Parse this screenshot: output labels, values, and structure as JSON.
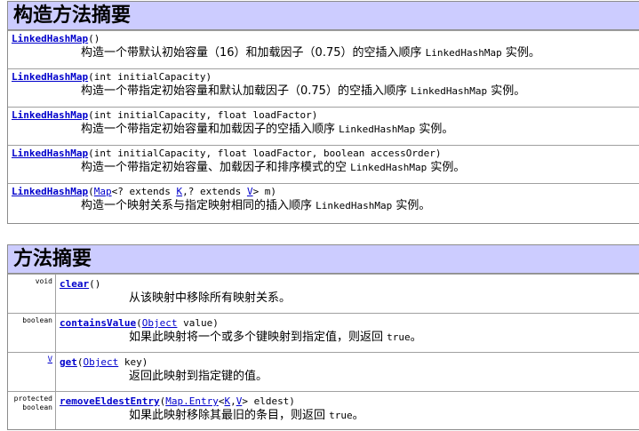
{
  "constructors": {
    "heading": "构造方法摘要",
    "rows": [
      {
        "name": "LinkedHashMap",
        "params": "()",
        "desc": "构造一个带默认初始容量（16）和加载因子（0.75）的空插入顺序 ",
        "desc_code": "LinkedHashMap",
        "desc_tail": " 实例。"
      },
      {
        "name": "LinkedHashMap",
        "params": "(int initialCapacity)",
        "desc": "构造一个带指定初始容量和默认加载因子（0.75）的空插入顺序 ",
        "desc_code": "LinkedHashMap",
        "desc_tail": " 实例。"
      },
      {
        "name": "LinkedHashMap",
        "params": "(int initialCapacity, float loadFactor)",
        "desc": "构造一个带指定初始容量和加载因子的空插入顺序 ",
        "desc_code": "LinkedHashMap",
        "desc_tail": " 实例。"
      },
      {
        "name": "LinkedHashMap",
        "params": "(int initialCapacity, float loadFactor, boolean accessOrder)",
        "desc": "构造一个带指定初始容量、加载因子和排序模式的空 ",
        "desc_code": "LinkedHashMap",
        "desc_tail": " 实例。"
      },
      {
        "name": "LinkedHashMap",
        "params_open": "(",
        "type_map": "Map",
        "params_mid1": "<? extends ",
        "type_k": "K",
        "params_mid2": ",? extends ",
        "type_v": "V",
        "params_close": "> m)",
        "desc": "构造一个映射关系与指定映射相同的插入顺序 ",
        "desc_code": "LinkedHashMap",
        "desc_tail": " 实例。"
      }
    ]
  },
  "methods": {
    "heading": "方法摘要",
    "rows": [
      {
        "modifier": "void",
        "name": "clear",
        "params": "()",
        "desc": "从该映射中移除所有映射关系。"
      },
      {
        "modifier": "boolean",
        "name": "containsValue",
        "params_open": "(",
        "type_obj": "Object",
        "params_close": " value)",
        "desc": "如果此映射将一个或多个键映射到指定值，则返回 ",
        "desc_code": "true",
        "desc_tail": "。"
      },
      {
        "modifier_link": "V",
        "name": "get",
        "params_open": "(",
        "type_obj": "Object",
        "params_close": " key)",
        "desc": "返回此映射到指定键的值。"
      },
      {
        "modifier_line1": "protected",
        "modifier_line2": "boolean",
        "name": "removeEldestEntry",
        "params_open": "(",
        "type_entry": "Map.Entry",
        "params_lt": "<",
        "type_k": "K",
        "params_comma": ",",
        "type_v": "V",
        "params_close": "> eldest)",
        "desc": "如果此映射移除其最旧的条目，则返回 ",
        "desc_code": "true",
        "desc_tail": "。"
      }
    ]
  }
}
